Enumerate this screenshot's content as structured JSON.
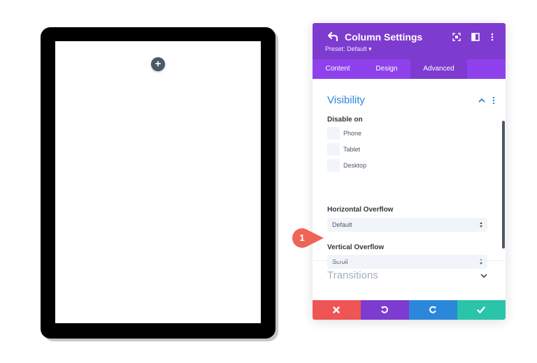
{
  "canvas": {
    "add_button_label": "+"
  },
  "panel": {
    "title": "Column Settings",
    "preset": "Preset: Default ▾",
    "tabs": [
      {
        "label": "Content",
        "active": false
      },
      {
        "label": "Design",
        "active": false
      },
      {
        "label": "Advanced",
        "active": true
      }
    ],
    "visibility": {
      "title": "Visibility",
      "disable_on_label": "Disable on",
      "options": [
        {
          "label": "Phone",
          "checked": false
        },
        {
          "label": "Tablet",
          "checked": false
        },
        {
          "label": "Desktop",
          "checked": false
        }
      ]
    },
    "horizontal_overflow": {
      "label": "Horizontal Overflow",
      "value": "Default"
    },
    "vertical_overflow": {
      "label": "Vertical Overflow",
      "value": "Scroll"
    },
    "transitions": {
      "title": "Transitions"
    }
  },
  "callout": {
    "number": "1"
  },
  "colors": {
    "header": "#7e3bd0",
    "tabs": "#8f42ec",
    "accent_blue": "#2b87da",
    "cancel": "#ef5555",
    "undo": "#7e3bd0",
    "redo": "#2b87da",
    "save": "#29c4a9",
    "callout": "#ee6456"
  }
}
